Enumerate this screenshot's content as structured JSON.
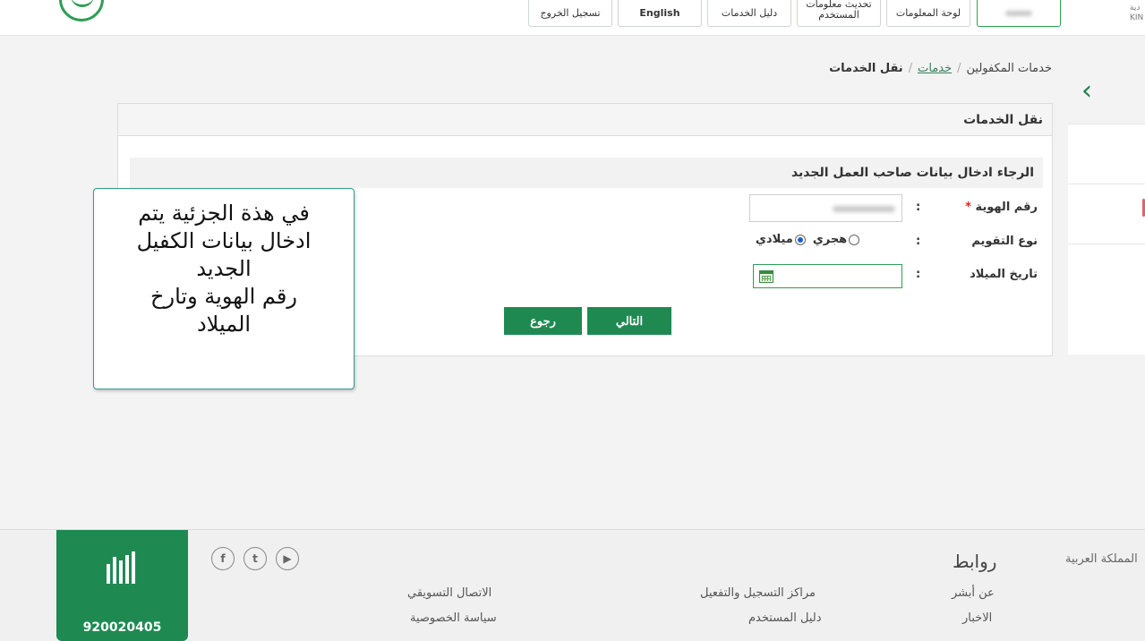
{
  "header": {
    "logout": "تسجيل الخروج",
    "language": "English",
    "services_guide": "دليل الخدمات",
    "user_line1": "تحديث معلومات",
    "user_line2": "المستخدم",
    "dashboard": "لوحة المعلومات",
    "corner_line1": "دية",
    "corner_line2": "KIN"
  },
  "breadcrumb": {
    "root": "خدمات المكفولين",
    "sep": "/",
    "services": "خدمات",
    "current": "نقل الخدمات"
  },
  "card": {
    "title": "نقل الخدمات",
    "section_title": "الرجاء ادخال بيانات صاحب العمل الجديد",
    "id_label": "رقم الهوية",
    "required_mark": "*",
    "calendar_label": "نوع التقويم",
    "colon": ":",
    "hijri": "هجري",
    "gregorian": "ميلادي",
    "birthdate_label": "تاريخ الميلاد",
    "next_button": "التالي",
    "back_button": "رجوع"
  },
  "callout": {
    "line1": "في هذة الجزئية يتم",
    "line2": "ادخال بيانات الكفيل",
    "line3": "الجديد",
    "line4": "رقم الهوية وتارخ",
    "line5": "الميلاد"
  },
  "footer": {
    "phone": "920020405",
    "links_heading": "روابط",
    "corner": "المملكة العربية",
    "about": "عن أبشر",
    "news": "الاخبار",
    "registration_centers": "مراكز التسجيل والتفعيل",
    "user_guide": "دليل المستخدم",
    "marketing": "الاتصال التسويقي",
    "privacy": "سياسة الخصوصية",
    "social_facebook": "f",
    "social_twitter": "t",
    "social_youtube": "▶"
  },
  "colors": {
    "brand_green": "#1e8a52",
    "callout_border": "#2e9e8e",
    "required_red": "#e02222"
  }
}
